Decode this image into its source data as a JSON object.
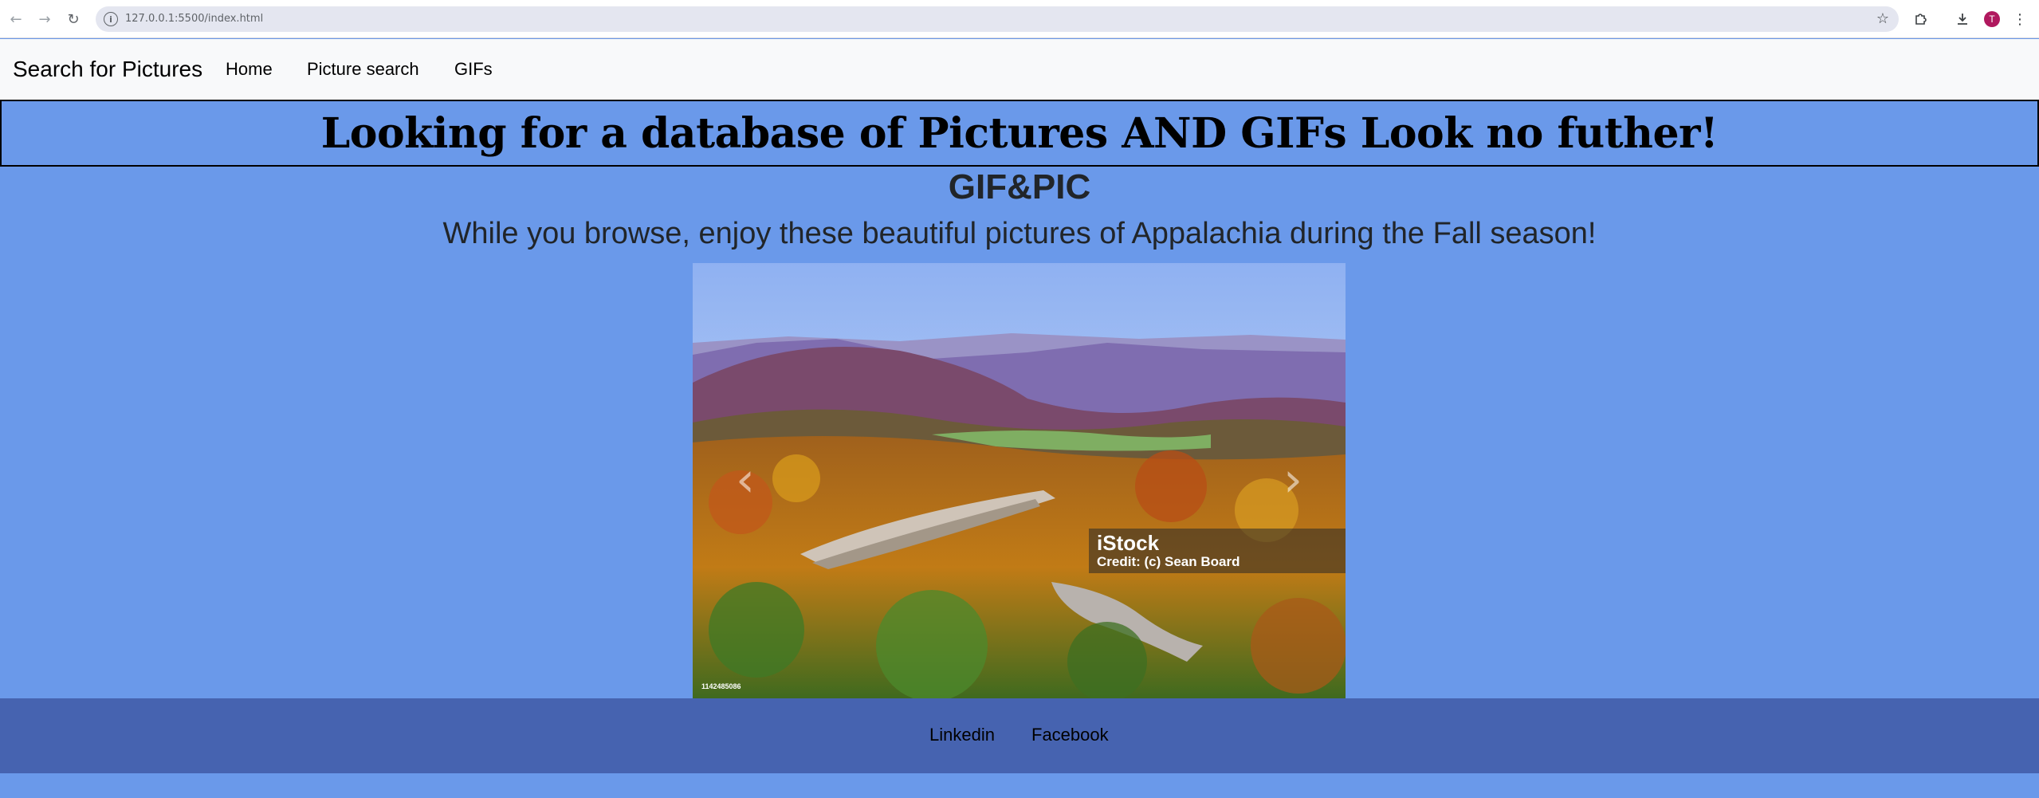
{
  "browser": {
    "url": "127.0.0.1:5500/index.html",
    "avatar_letter": "T",
    "icons": {
      "back": "arrow-left-icon",
      "forward": "arrow-right-icon",
      "reload": "reload-icon",
      "site_info": "info-icon",
      "bookmark": "star-icon",
      "extensions": "puzzle-icon",
      "downloads": "download-icon",
      "menu": "kebab-menu-icon"
    }
  },
  "navbar": {
    "brand": "Search for Pictures",
    "links": [
      "Home",
      "Picture search",
      "GIFs"
    ]
  },
  "banner": {
    "text": "Looking for a database of Pictures AND GIFs Look no futher!"
  },
  "subtitle": "GIF&PIC",
  "tagline": "While you browse, enjoy these beautiful pictures of Appalachia during the Fall season!",
  "carousel": {
    "prev_icon": "chevron-left-icon",
    "next_icon": "chevron-right-icon",
    "credit_brand": "iStock",
    "credit_text": "Credit: (c) Sean Board",
    "stock_id": "1142485086"
  },
  "footer": {
    "links": [
      "Linkedin",
      "Facebook"
    ]
  },
  "colors": {
    "page_background": "#6a99ea",
    "footer_background": "#4663b0",
    "navbar_background": "#f8f9fa"
  }
}
